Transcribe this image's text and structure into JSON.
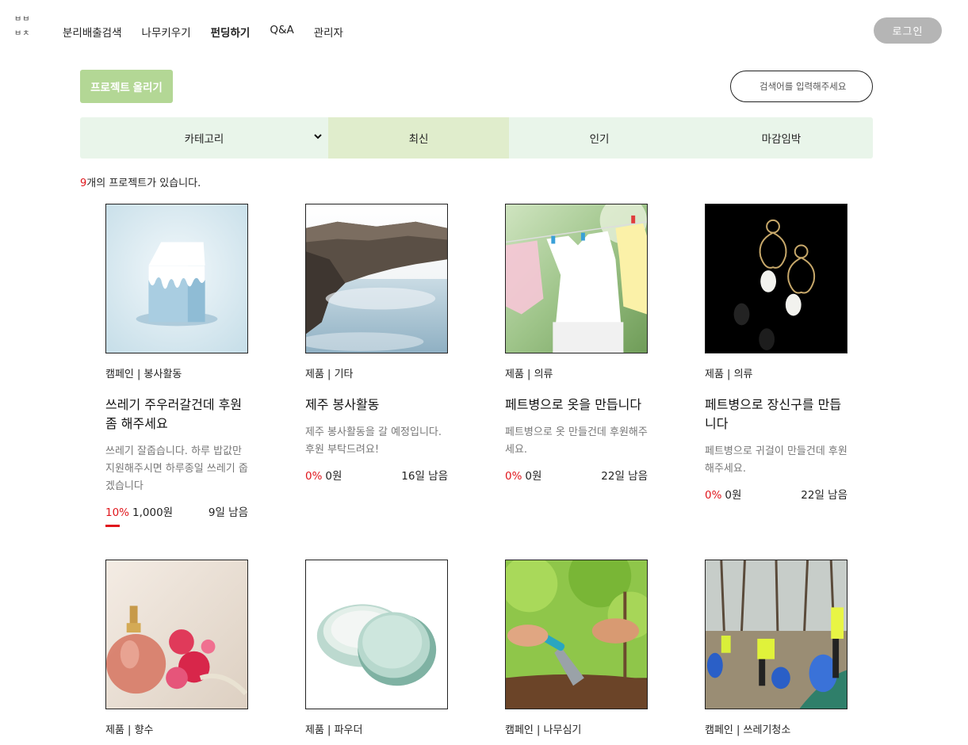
{
  "logo": {
    "line1": "ㅂㅂ",
    "line2": "ㅂㅊ"
  },
  "nav": [
    {
      "label": "분리배출검색",
      "active": false
    },
    {
      "label": "나무키우기",
      "active": false
    },
    {
      "label": "펀딩하기",
      "active": true
    },
    {
      "label": "Q&A",
      "active": false
    },
    {
      "label": "관리자",
      "active": false
    }
  ],
  "login_label": "로그인",
  "upload_label": "프로젝트 올리기",
  "search": {
    "placeholder": "검색어를 입력해주세요"
  },
  "filter": {
    "category_label": "카테고리",
    "tabs": [
      {
        "label": "최신",
        "selected": true
      },
      {
        "label": "인기",
        "selected": false
      },
      {
        "label": "마감임박",
        "selected": false
      }
    ]
  },
  "count": {
    "number": "9",
    "text": "개의 프로젝트가 있습니다."
  },
  "colors": {
    "accent_green": "#b3d795",
    "filter_bg": "#e9f5ea",
    "filter_selected": "#e0edcc",
    "percent_red": "#e0161c",
    "login_gray": "#b5b5b5"
  },
  "cards": [
    {
      "image": "milk-carton-image",
      "category": "캠페인 | 봉사활동",
      "title": "쓰레기 주우러갈건데 후원좀 해주세요",
      "desc": "쓰레기 잘줍습니다. 하루 밥값만 지원해주시면 하루종일 쓰레기 줍겠습니다",
      "percent": "10%",
      "progress": 0.1,
      "amount": "1,000원",
      "days": "9일 남음"
    },
    {
      "image": "jeju-coast-image",
      "category": "제품 | 기타",
      "title": "제주 봉사활동",
      "desc": "제주 봉사활동을 갈 예정입니다. 후원 부탁드려요!",
      "percent": "0%",
      "progress": 0,
      "amount": "0원",
      "days": "16일 남음"
    },
    {
      "image": "laundry-clothes-image",
      "category": "제품 | 의류",
      "title": "페트병으로 옷을 만듭니다",
      "desc": "페트병으로 옷 만들건데 후원해주세요.",
      "percent": "0%",
      "progress": 0,
      "amount": "0원",
      "days": "22일 남음"
    },
    {
      "image": "pearl-earrings-image",
      "category": "제품 | 의류",
      "title": "페트병으로 장신구를 만듭니다",
      "desc": "페트병으로 귀걸이 만들건데 후원해주세요.",
      "percent": "0%",
      "progress": 0,
      "amount": "0원",
      "days": "22일 남음"
    },
    {
      "image": "perfume-bottle-image",
      "category": "제품 | 향수"
    },
    {
      "image": "powder-compact-image",
      "category": "제품 | 파우더"
    },
    {
      "image": "tree-planting-image",
      "category": "캠페인 | 나무심기"
    },
    {
      "image": "trash-cleanup-image",
      "category": "캠페인 | 쓰레기청소"
    }
  ]
}
